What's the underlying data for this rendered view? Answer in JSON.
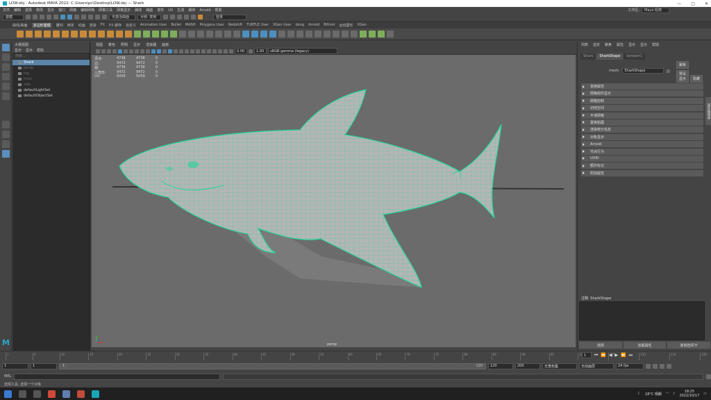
{
  "titlebar": {
    "title": "LOW.obj - Autodesk MAYA 2022: C:\\Users\\pc\\Desktop\\LOW.obj   ---   Shark",
    "min": "—",
    "max": "□",
    "close": "✕"
  },
  "menubar": {
    "items": [
      "文件",
      "编辑",
      "选择",
      "修改",
      "显示",
      "窗口",
      "网格",
      "编辑网格",
      "网格工具",
      "网格显示",
      "曲线",
      "曲面",
      "变形",
      "UV",
      "生成",
      "缓存",
      "Arnold",
      "帮助"
    ],
    "workspace_label": "工作区:",
    "workspace_value": "Maya 经典"
  },
  "statusline": {
    "mode": "建模",
    "no_live": "无激活曲面",
    "symmetry": "对称: 禁用",
    "login": "登录"
  },
  "shelf": {
    "tabs": [
      "曲线/曲面",
      "多边形建模",
      "雕刻",
      "绑定",
      "动画",
      "渲染",
      "FX",
      "FX 缓存",
      "自定义",
      "Animation User",
      "Bullet",
      "MASH",
      "Polygons User",
      "Redshift",
      "TURTLE User",
      "XGen User",
      "deng",
      "Arnold",
      "Bifrost",
      "运动图形",
      "XGen"
    ],
    "active_tab": "多边形建模"
  },
  "outliner": {
    "title": "大纲视图",
    "menu": [
      "显示",
      "显示",
      "帮助"
    ],
    "search_placeholder": "搜索...",
    "items": [
      {
        "label": "Shark",
        "selected": true,
        "dim": false
      },
      {
        "label": "persp",
        "selected": false,
        "dim": true
      },
      {
        "label": "top",
        "selected": false,
        "dim": true
      },
      {
        "label": "front",
        "selected": false,
        "dim": true
      },
      {
        "label": "side",
        "selected": false,
        "dim": true
      },
      {
        "label": "defaultLightSet",
        "selected": false,
        "dim": false
      },
      {
        "label": "defaultObjectSet",
        "selected": false,
        "dim": false
      }
    ]
  },
  "viewport": {
    "menu": [
      "视图",
      "着色",
      "照明",
      "显示",
      "渲染器",
      "面板"
    ],
    "field_a": "0.00",
    "field_b": "1.00",
    "colorspace": "sRGB gamma (legacy)",
    "hud": [
      {
        "label": "顶点:",
        "a": "4738",
        "b": "4738",
        "c": "0"
      },
      {
        "label": "边:",
        "a": "9472",
        "b": "9472",
        "c": "0"
      },
      {
        "label": "面:",
        "a": "4736",
        "b": "4736",
        "c": "0"
      },
      {
        "label": "三角形:",
        "a": "9472",
        "b": "9472",
        "c": "0"
      },
      {
        "label": "UV:",
        "a": "5059",
        "b": "5059",
        "c": "0"
      }
    ],
    "camera": "persp"
  },
  "channelbox": {
    "menu": [
      "列表",
      "选定",
      "聚焦",
      "属性",
      "显示",
      "显示",
      "帮助"
    ],
    "tabs": [
      "Shark",
      "SharkShape",
      "lambert1"
    ],
    "active_tab": "SharkShape",
    "mesh_label": "mesh:",
    "mesh_value": "SharkShape",
    "btn_focus": "聚焦",
    "btn_preset": "预设",
    "btn_show": "显示",
    "btn_hide": "隐藏",
    "sections": [
      "变换属性",
      "网格组件显示",
      "网格控制",
      "切线空间",
      "平滑网格",
      "置换贴图",
      "渲染统计信息",
      "对象显示",
      "Arnold",
      "节点行为",
      "UUID",
      "额外标记",
      "附加属性"
    ],
    "notes_label": "注释: SharkShape",
    "buttons": [
      "选择",
      "加载属性",
      "复制选项卡"
    ],
    "side_tab": "属性编辑器"
  },
  "timeslider": {
    "ticks": [
      "1",
      "5",
      "10",
      "15",
      "20",
      "25",
      "30",
      "35",
      "40",
      "45",
      "50",
      "55",
      "60",
      "65",
      "70",
      "75",
      "80",
      "85",
      "90",
      "95",
      "100",
      "105",
      "110",
      "115",
      "120"
    ],
    "current": "1"
  },
  "range": {
    "start": "1",
    "anim_start": "1",
    "track_left": "1",
    "track_right": "120",
    "end": "120",
    "anim_end": "200",
    "charset": "无角色集",
    "anim_layer": "无动画层",
    "fps": "24 fps"
  },
  "cmdline": {
    "label": "MEL"
  },
  "helpline": {
    "text": "选择工具: 选择一个对象"
  },
  "taskbar": {
    "weather": "18°C 晴朗",
    "time": "18:25",
    "date": "2022/10/17"
  }
}
